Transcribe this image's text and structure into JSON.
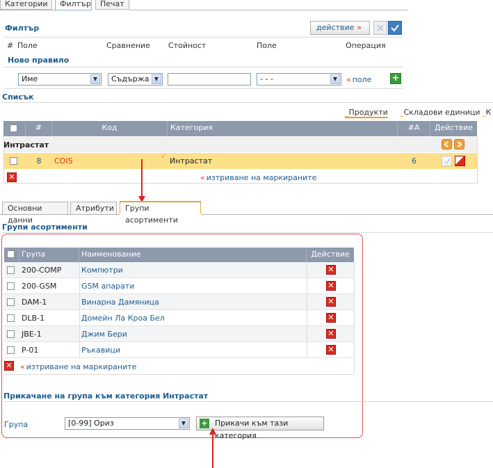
{
  "top_tabs": [
    "Категории",
    "Филтър",
    "Печат"
  ],
  "filter": {
    "title": "Филтър",
    "action_label": "действие",
    "action_raquo": "»",
    "columns": [
      "#",
      "Поле",
      "Сравнение",
      "Стойност",
      "Поле",
      "Операция"
    ],
    "new_rule_label": "Ново правило",
    "field_select": "Име",
    "comparison_select": "Съдържа",
    "value_input": "",
    "field2_select": "- - -",
    "field_link_quote": "«",
    "field_link": "поле"
  },
  "list": {
    "title": "Списък",
    "tabs": [
      "Продукти",
      "Складови единици",
      "К"
    ],
    "headers": [
      "#",
      "Код",
      "Категория",
      "#A",
      "Действие"
    ],
    "group_label": "Интрастат",
    "row": {
      "num": "8",
      "code": "COIS",
      "category": "Интрастат",
      "count": "6"
    },
    "delete_quote": "«",
    "delete_marked": "изтриване на маркираните"
  },
  "detail_tabs": [
    "Основни данни",
    "Атрибути",
    "Групи асортименти"
  ],
  "groups": {
    "title": "Групи асортименти",
    "headers": [
      "Група",
      "Наименование",
      "Действие"
    ],
    "rows": [
      {
        "code": "200-COMP",
        "name": "Компютри"
      },
      {
        "code": "200-GSM",
        "name": "GSM апарати"
      },
      {
        "code": "DAM-1",
        "name": "Винарна Дамяница"
      },
      {
        "code": "DLB-1",
        "name": "Домейн Ла Кроа Бел"
      },
      {
        "code": "JBE-1",
        "name": "Джим Бери"
      },
      {
        "code": "P-01",
        "name": "Ръкавици"
      }
    ],
    "delete_quote": "«",
    "delete_marked": "изтриване на маркираните"
  },
  "attach": {
    "title": "Прикачане на група към категория Интрастат",
    "group_label": "Група",
    "group_select": "[0-99] Ориз",
    "attach_button": "Прикачи към тази категория"
  },
  "colors": {
    "accent": "#1d5c8f",
    "highlight_row": "#fde08a",
    "annotation": "#e02020",
    "grid_header": "#8c9aab"
  }
}
